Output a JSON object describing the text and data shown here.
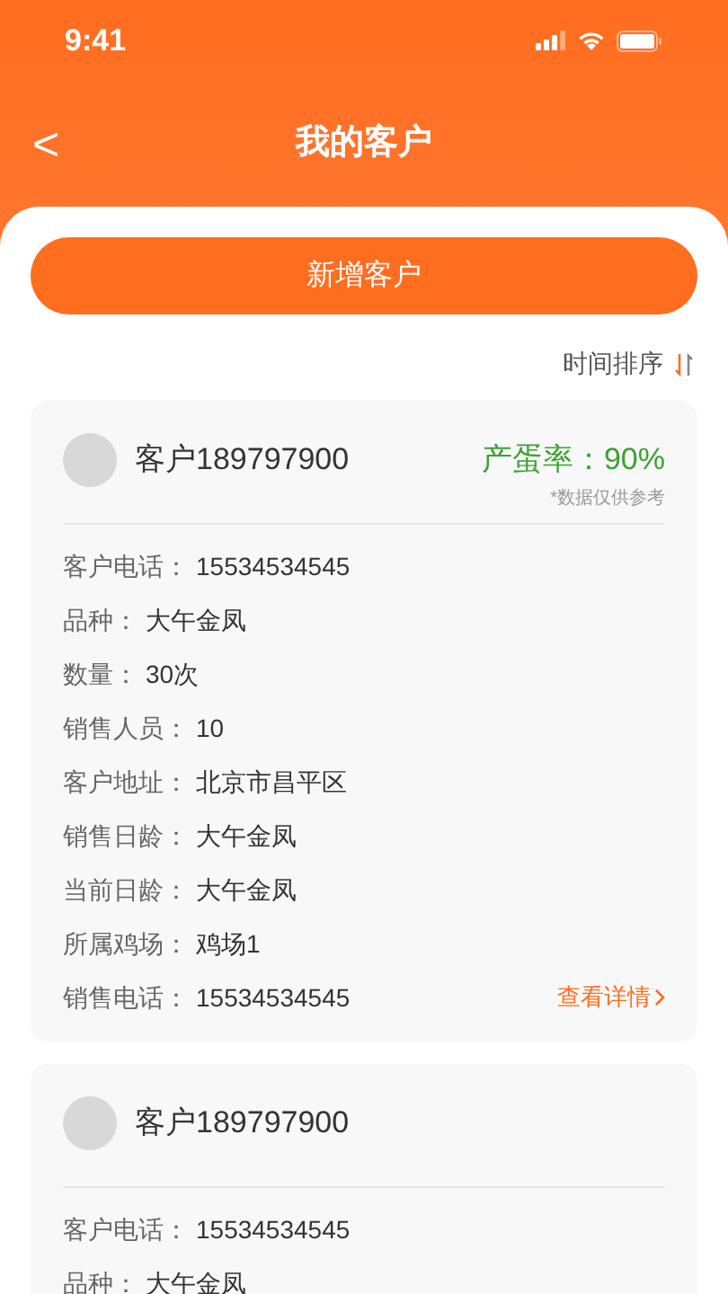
{
  "status_bar": {
    "time": "9:41"
  },
  "nav": {
    "back": "<",
    "title": "我的客户"
  },
  "add_button": "新增客户",
  "sort": {
    "label": "时间排序"
  },
  "customers": [
    {
      "name": "客户189797900",
      "rate": "产蛋率：90%",
      "note": "*数据仅供参考",
      "fields": [
        {
          "label": "客户电话：",
          "value": "15534534545"
        },
        {
          "label": "品种：",
          "value": "大午金凤"
        },
        {
          "label": "数量：",
          "value": "30次"
        },
        {
          "label": "销售人员：",
          "value": "10"
        },
        {
          "label": "客户地址：",
          "value": "北京市昌平区"
        },
        {
          "label": "销售日龄：",
          "value": "大午金凤"
        },
        {
          "label": "当前日龄：",
          "value": "大午金凤"
        },
        {
          "label": "所属鸡场：",
          "value": "鸡场1"
        },
        {
          "label": "销售电话：",
          "value": "15534534545"
        }
      ],
      "link": "查看详情"
    },
    {
      "name": "客户189797900",
      "fields": [
        {
          "label": "客户电话：",
          "value": "15534534545"
        },
        {
          "label": "品种：",
          "value": "大午金凤"
        }
      ]
    }
  ]
}
